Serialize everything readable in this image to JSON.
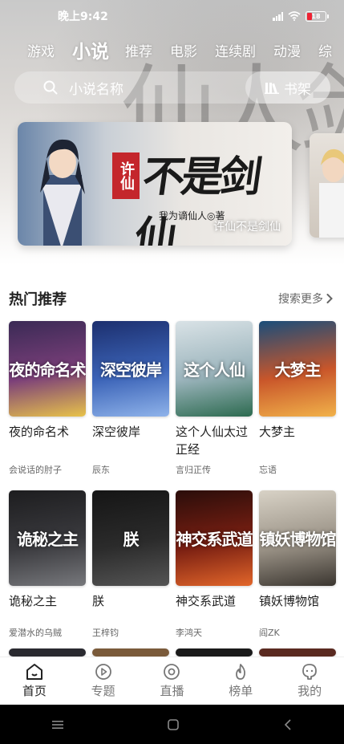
{
  "status_bar": {
    "time": "晚上9:42",
    "battery": "18"
  },
  "tabs": [
    {
      "label": "游戏",
      "active": false
    },
    {
      "label": "小说",
      "active": true
    },
    {
      "label": "推荐",
      "active": false
    },
    {
      "label": "电影",
      "active": false
    },
    {
      "label": "连续剧",
      "active": false
    },
    {
      "label": "动漫",
      "active": false
    },
    {
      "label": "综",
      "active": false
    }
  ],
  "search": {
    "placeholder": "小说名称",
    "bookshelf_label": "书架"
  },
  "banner": {
    "seal": "许仙",
    "title_art": "不是剑仙",
    "author_line": "我为谪仙人◎著",
    "caption": "许仙不是剑仙"
  },
  "hot": {
    "title": "热门推荐",
    "more": "搜索更多"
  },
  "books": [
    {
      "title": "夜的命名术",
      "author": "会说话的肘子",
      "cover_text": "夜的命名术",
      "colors": [
        "#3a2a55",
        "#7b3f7a",
        "#e8c34a"
      ]
    },
    {
      "title": "深空彼岸",
      "author": "辰东",
      "cover_text": "深空彼岸",
      "colors": [
        "#1c2f6e",
        "#3c64b8",
        "#8fb3ea"
      ]
    },
    {
      "title": "这个人仙太过正经",
      "author": "言归正传",
      "cover_text": "这个人仙",
      "colors": [
        "#d9e2e6",
        "#9bb4bc",
        "#2c6a4f"
      ]
    },
    {
      "title": "大梦主",
      "author": "忘语",
      "cover_text": "大梦主",
      "colors": [
        "#1a4d7a",
        "#c9562a",
        "#f1b24a"
      ]
    },
    {
      "title": "诡秘之主",
      "author": "爱潜水的乌贼",
      "cover_text": "诡秘之主",
      "colors": [
        "#1d1d1f",
        "#3a3a3e",
        "#77787c"
      ]
    },
    {
      "title": "朕",
      "author": "王梓钧",
      "cover_text": "朕",
      "colors": [
        "#151515",
        "#2b2b2b",
        "#555555"
      ]
    },
    {
      "title": "神交系武道",
      "author": "李鸿天",
      "cover_text": "神交系武道",
      "colors": [
        "#2a0d0a",
        "#7a1f12",
        "#e2662a"
      ]
    },
    {
      "title": "镇妖博物馆",
      "author": "阎ZK",
      "cover_text": "镇妖博物馆",
      "colors": [
        "#d8d2c6",
        "#9a9286",
        "#3b3630"
      ]
    }
  ],
  "bottom_nav": [
    {
      "label": "首页",
      "icon": "home-icon",
      "active": true
    },
    {
      "label": "专题",
      "icon": "play-icon",
      "active": false
    },
    {
      "label": "直播",
      "icon": "live-icon",
      "active": false
    },
    {
      "label": "榜单",
      "icon": "flame-icon",
      "active": false
    },
    {
      "label": "我的",
      "icon": "profile-icon",
      "active": false
    }
  ]
}
